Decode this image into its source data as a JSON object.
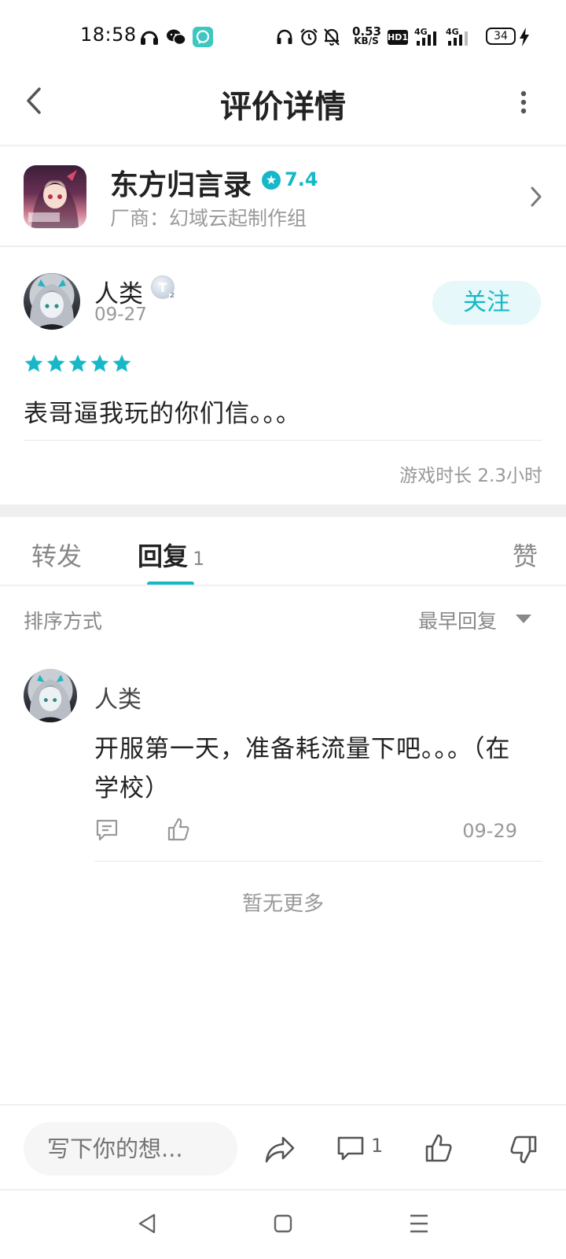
{
  "status_bar": {
    "time": "18:58",
    "net_speed_value": "0.53",
    "net_speed_unit": "KB/S",
    "hd_label": "HD1",
    "signal_1_label": "4G",
    "signal_2_label": "4G",
    "battery": "34",
    "icons": [
      "music-app-icon",
      "wechat-icon",
      "chat-bubble-icon",
      "headphones-icon",
      "alarm-icon",
      "mute-icon",
      "signal-icon",
      "charging-icon"
    ]
  },
  "header": {
    "title": "评价详情",
    "icons": [
      "back-icon",
      "more-icon"
    ]
  },
  "game": {
    "name": "东方归言录",
    "rating": "7.4",
    "developer": "厂商：幻域云起制作组",
    "accent_color": "#16b8c7"
  },
  "review": {
    "user_name": "人类",
    "level_badge": "T",
    "level_number": "2",
    "date": "09-27",
    "follow_label": "关注",
    "stars": 5,
    "text": "表哥逼我玩的你们信。。。",
    "play_time": "游戏时长 2.3小时"
  },
  "tabs": {
    "share": "转发",
    "reply": "回复",
    "reply_count": "1",
    "like": "赞"
  },
  "sort": {
    "label": "排序方式",
    "selected": "最早回复"
  },
  "reply": {
    "user_name": "人类",
    "text": "开服第一天，准备耗流量下吧。。。（在学校）",
    "date": "09-29"
  },
  "no_more": "暂无更多",
  "bottom_bar": {
    "input_placeholder": "写下你的想...",
    "comment_count": "1"
  }
}
